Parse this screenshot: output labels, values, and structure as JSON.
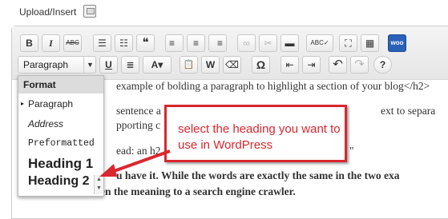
{
  "header": {
    "upload_label": "Upload/Insert"
  },
  "toolbar": {
    "row1": [
      {
        "name": "bold-button",
        "label": "B"
      },
      {
        "name": "italic-button",
        "label": "I"
      },
      {
        "name": "strikethrough-button",
        "label": "ABC"
      },
      {
        "name": "bullet-list-button",
        "label": "☰"
      },
      {
        "name": "numbered-list-button",
        "label": "☷"
      },
      {
        "name": "blockquote-button",
        "label": "❝"
      },
      {
        "name": "align-left-button",
        "label": "≡"
      },
      {
        "name": "align-center-button",
        "label": "≡"
      },
      {
        "name": "align-right-button",
        "label": "≡"
      },
      {
        "name": "insert-link-button",
        "label": "∞"
      },
      {
        "name": "unlink-button",
        "label": "✂"
      },
      {
        "name": "insert-more-button",
        "label": "▬"
      },
      {
        "name": "spellcheck-button",
        "label": "ABC✓"
      },
      {
        "name": "fullscreen-button",
        "label": "⛶"
      },
      {
        "name": "kitchen-sink-button",
        "label": "▦"
      },
      {
        "name": "woo-button",
        "label": "woo"
      }
    ],
    "row2": [
      {
        "name": "underline-button",
        "label": "U"
      },
      {
        "name": "justify-button",
        "label": "≣"
      },
      {
        "name": "text-color-button",
        "label": "A▾"
      },
      {
        "name": "paste-text-button",
        "label": "📋"
      },
      {
        "name": "paste-word-button",
        "label": "W"
      },
      {
        "name": "clear-formatting-button",
        "label": "⌫"
      },
      {
        "name": "special-char-button",
        "label": "Ω"
      },
      {
        "name": "outdent-button",
        "label": "⇤"
      },
      {
        "name": "indent-button",
        "label": "⇥"
      },
      {
        "name": "undo-button",
        "label": "↶"
      },
      {
        "name": "redo-button",
        "label": "↷"
      },
      {
        "name": "help-button",
        "label": "?"
      }
    ],
    "format_select": "Paragraph",
    "format_arrow": "▼"
  },
  "dropdown": {
    "header": "Format",
    "items": [
      "Paragraph",
      "Address",
      "Preformatted",
      "Heading 1",
      "Heading 2"
    ],
    "selected_marker": "▸"
  },
  "content": {
    "line1": "example of bolding a paragraph to highlight a section of your blog</h2>",
    "line2a": "sentence a",
    "line2b": "ext to separa",
    "line3": "pporting c",
    "line4a": "ead: an h2",
    "line4b": "\"",
    "line5": "u have it.  While the words are exactly the same in the two exa",
    "line6": "en the meaning to a search engine crawler."
  },
  "callout": {
    "text": "select the heading you want to use in WordPress",
    "color": "#d9272e"
  }
}
